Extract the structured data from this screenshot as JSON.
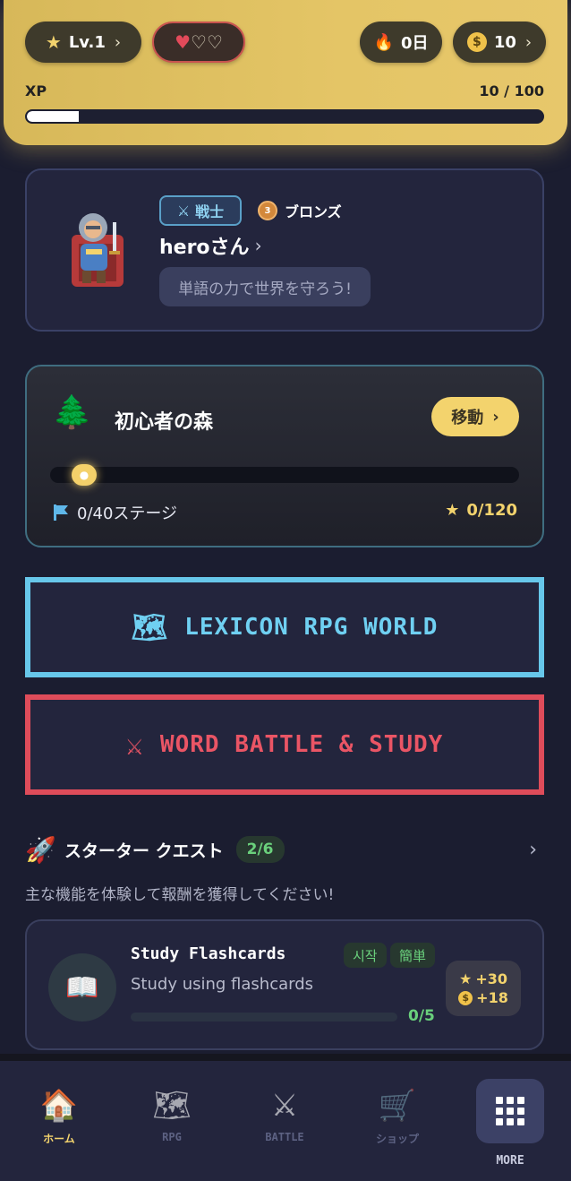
{
  "header": {
    "level_label": "Lv.1",
    "streak_label": "0日",
    "coins_label": "10",
    "xp_label": "XP",
    "xp_value": "10 / 100",
    "xp_progress": 0.1,
    "hearts_full": 1,
    "hearts_total": 3
  },
  "profile": {
    "class_label": "戦士",
    "rank_label": "ブロンズ",
    "username": "heroさん",
    "motto": "単語の力で世界を守ろう!"
  },
  "forest": {
    "title": "初心者の森",
    "move_label": "移動",
    "stage_label": "0/40ステージ",
    "stars_label": "0/120",
    "progress": 0.0
  },
  "big_buttons": {
    "rpg_label": "LEXICON RPG WORLD",
    "battle_label": "WORD BATTLE & STUDY"
  },
  "quest": {
    "title": "スターター クエスト",
    "count": "2/6",
    "subtitle": "主な機能を体験して報酬を獲得してください!",
    "card": {
      "title": "Study Flashcards",
      "tag_start": "시작",
      "tag_easy": "簡単",
      "description": "Study using flashcards",
      "progress_label": "0/5",
      "reward_stars": "+30",
      "reward_coins": "+18"
    }
  },
  "nav": {
    "home": "ホーム",
    "rpg": "RPG",
    "battle": "BATTLE",
    "shop": "ショップ",
    "more": "MORE"
  },
  "colors": {
    "accent_gold": "#f3d36d",
    "rpg_blue": "#67c7ea",
    "battle_red": "#df4c5a",
    "quest_green": "#6ad07c"
  }
}
